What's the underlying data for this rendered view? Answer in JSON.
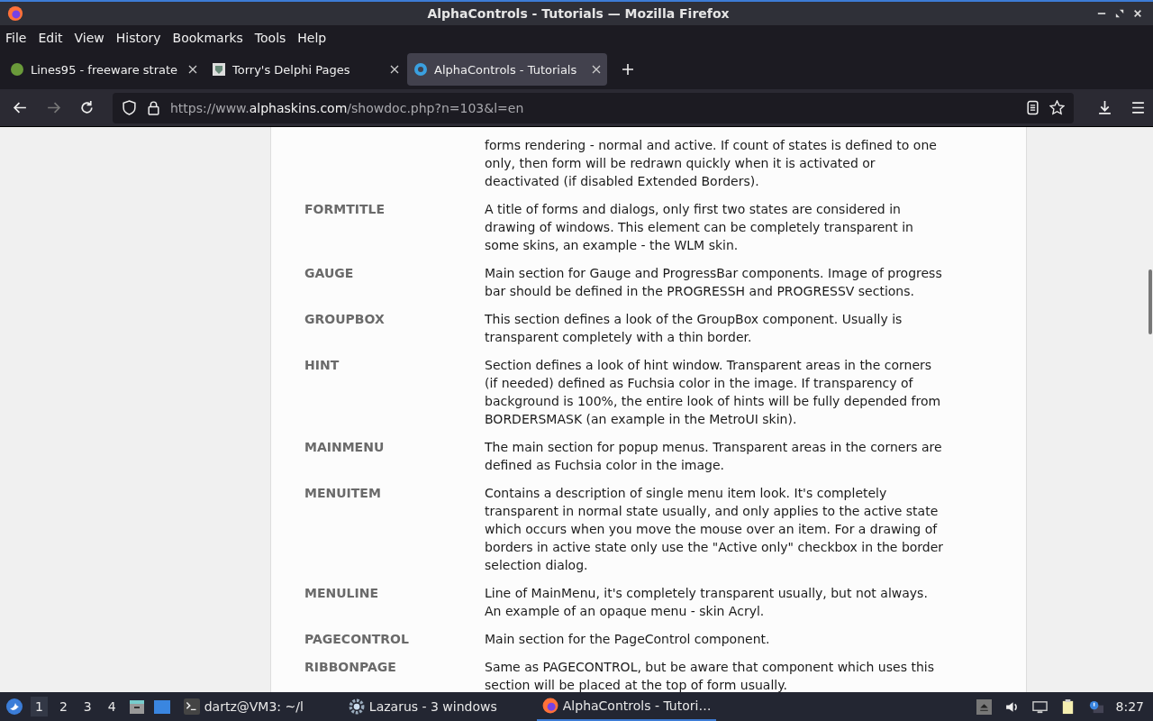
{
  "window": {
    "title": "AlphaControls - Tutorials — Mozilla Firefox"
  },
  "menu": [
    "File",
    "Edit",
    "View",
    "History",
    "Bookmarks",
    "Tools",
    "Help"
  ],
  "tabs": [
    {
      "label": "Lines95 - freeware strate",
      "selected": false,
      "kind": "green"
    },
    {
      "label": "Torry's Delphi Pages",
      "selected": false,
      "kind": "shield"
    },
    {
      "label": "AlphaControls - Tutorials",
      "selected": true,
      "kind": "ac"
    }
  ],
  "address": {
    "prefix": "https://www.",
    "domain": "alphaskins.com",
    "path": "/showdoc.php?n=103&l=en"
  },
  "sections": [
    {
      "description": "forms rendering - normal and active. If count of states is defined to one only, then form will be redrawn quickly when it is activated or deactivated (if disabled Extended Borders)."
    },
    {
      "name": "FORMTITLE",
      "description": "A title of forms and dialogs, only first two states are considered in drawing of windows. This element can be completely transparent in some skins, an example - the WLM skin."
    },
    {
      "name": "GAUGE",
      "description": "Main section for Gauge and ProgressBar components. Image of progress bar should be defined in the PROGRESSH and PROGRESSV sections."
    },
    {
      "name": "GROUPBOX",
      "description": "This section defines a look of the GroupBox component. Usually is transparent completely with a thin border."
    },
    {
      "name": "HINT",
      "description": "Section defines a look of hint window. Transparent areas in the corners (if needed) defined as Fuchsia color in the image. If transparency of background is 100%, the entire look of hints will be fully depended from BORDERSMASK (an example in the MetroUI skin)."
    },
    {
      "name": "MAINMENU",
      "description": "The main section for popup menus. Transparent areas in the corners are defined as Fuchsia color in the image."
    },
    {
      "name": "MENUITEM",
      "description": "Contains a description of single menu item look. It's completely transparent in normal state usually, and only applies to the active state which occurs when you move the mouse over an item. For a drawing of borders in active state only use the \"Active only\" checkbox in the border selection dialog."
    },
    {
      "name": "MENULINE",
      "description": "Line of MainMenu, it's completely transparent usually, but not always. An example of an opaque menu - skin Acryl."
    },
    {
      "name": "PAGECONTROL",
      "description": "Main section for the PageControl component."
    },
    {
      "name": "RIBBONPAGE",
      "description": "Same as PAGECONTROL, but be aware that component which uses this section will be placed at the top of form usually."
    }
  ],
  "taskbar": {
    "workspaces": [
      {
        "label": "1",
        "selected": true
      },
      {
        "label": "2",
        "selected": false
      },
      {
        "label": "3",
        "selected": false
      },
      {
        "label": "4",
        "selected": false
      }
    ],
    "tasks": [
      {
        "label": "dartz@VM3: ~/l",
        "kind": "terminal",
        "selected": false
      },
      {
        "label": "Lazarus - 3 windows",
        "kind": "gear",
        "selected": false
      },
      {
        "label": "AlphaControls - Tutori…",
        "kind": "firefox",
        "selected": true
      }
    ],
    "clock": "8:27"
  }
}
